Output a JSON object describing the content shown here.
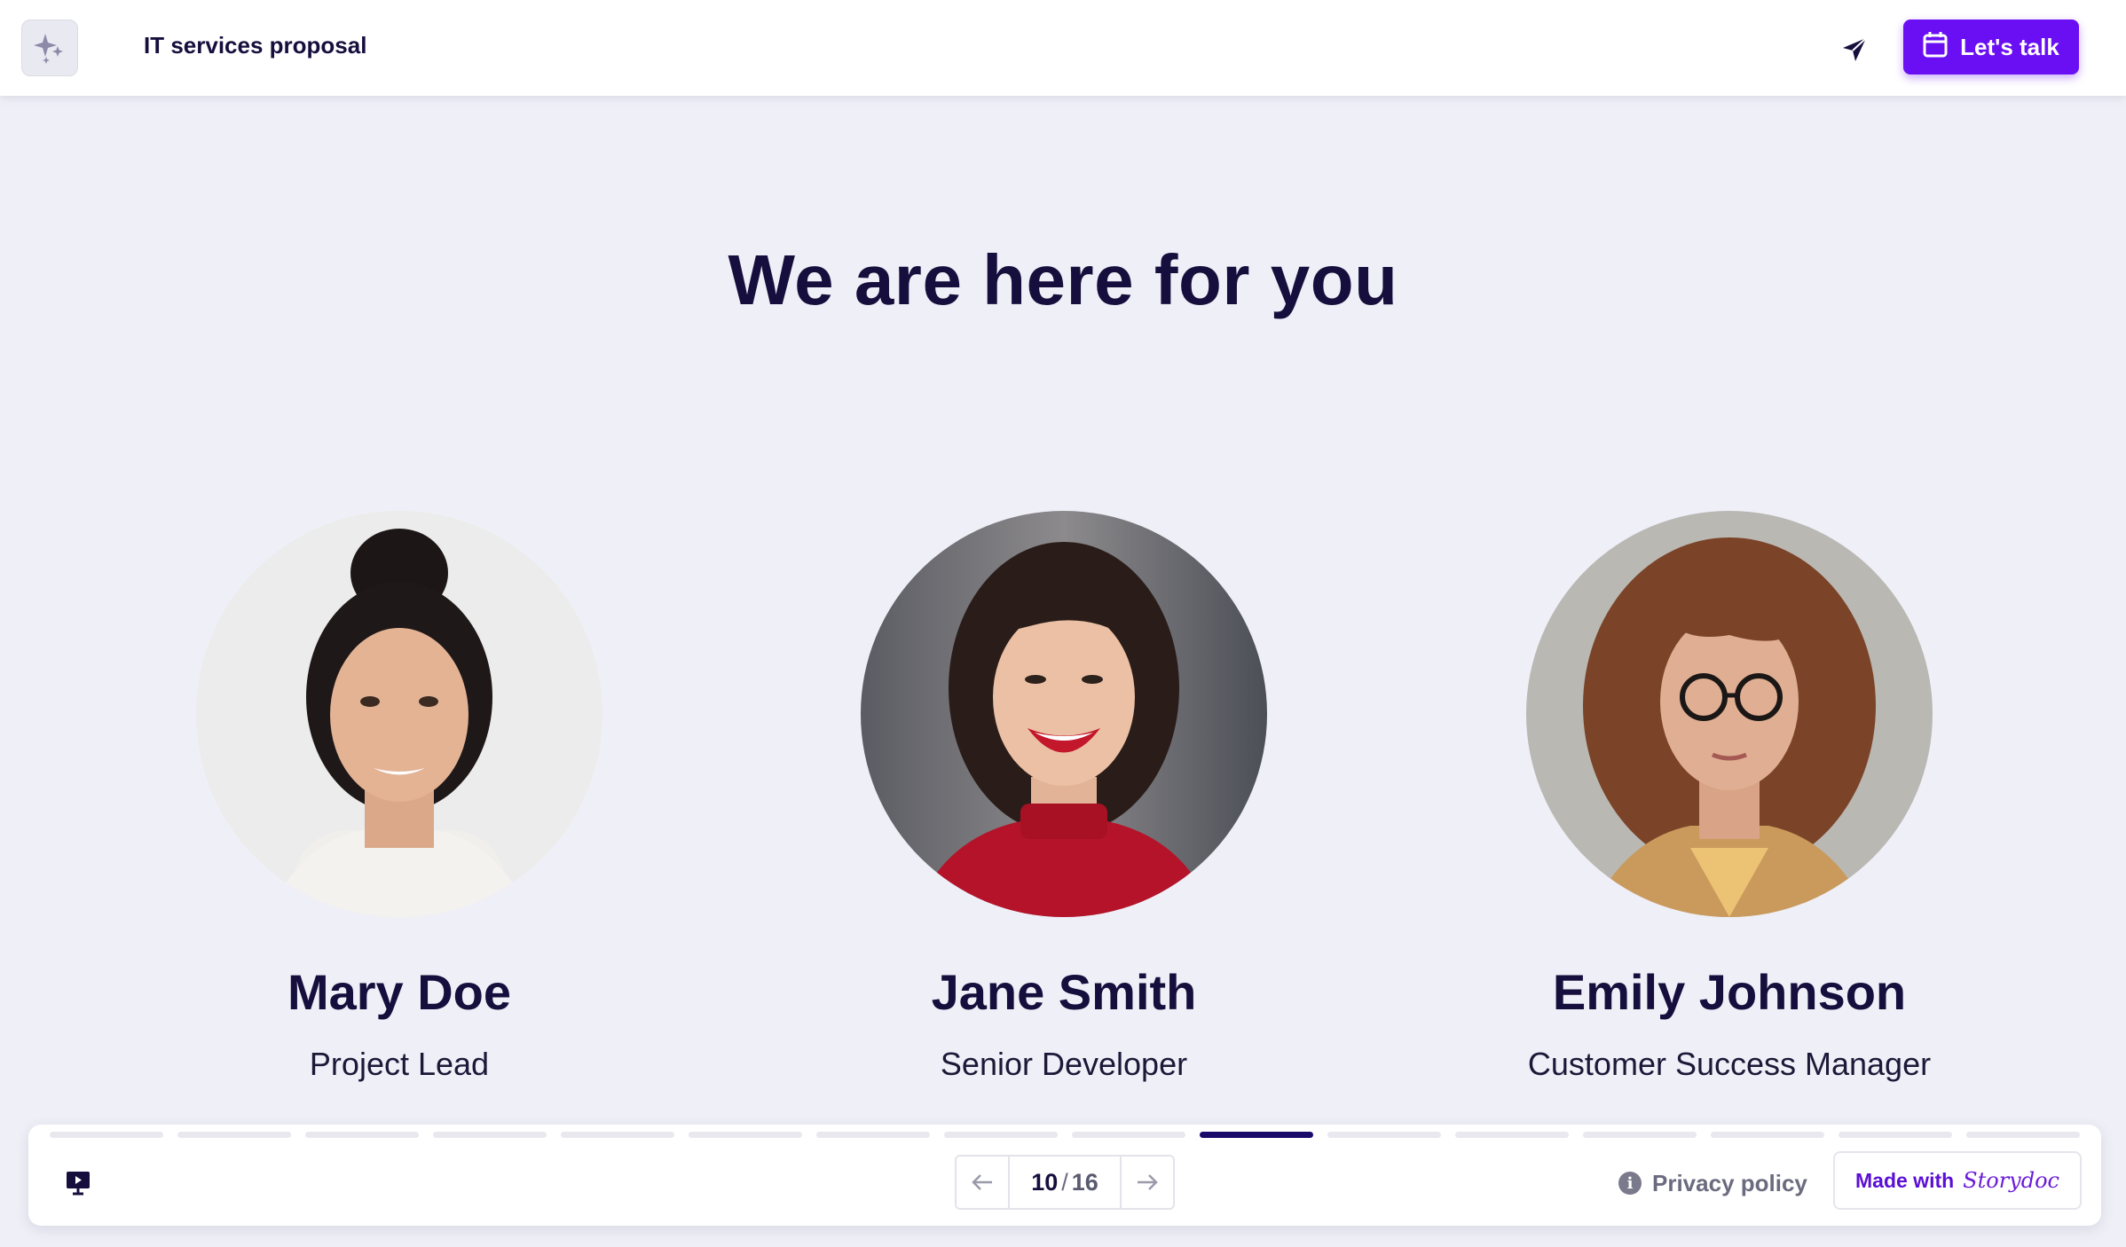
{
  "header": {
    "title": "IT services proposal",
    "logo_icon": "sparkles-icon",
    "share_icon": "send-icon",
    "cta_label": "Let's talk",
    "cta_icon": "calendar-icon",
    "accent_color": "#6a0ff3"
  },
  "main": {
    "heading": "We are here for you",
    "members": [
      {
        "name": "Mary Doe",
        "role": "Project Lead"
      },
      {
        "name": "Jane Smith",
        "role": "Senior Developer"
      },
      {
        "name": "Emily Johnson",
        "role": "Customer Success Manager"
      }
    ]
  },
  "footer": {
    "progress": {
      "total_segments": 16,
      "active_index": 10
    },
    "present_icon": "presentation-icon",
    "pager": {
      "current": "10",
      "separator": "/",
      "total": "16"
    },
    "privacy_label": "Privacy policy",
    "made_with_label": "Made with",
    "brand_name": "Storydoc",
    "active_color": "#1a0b6b"
  }
}
